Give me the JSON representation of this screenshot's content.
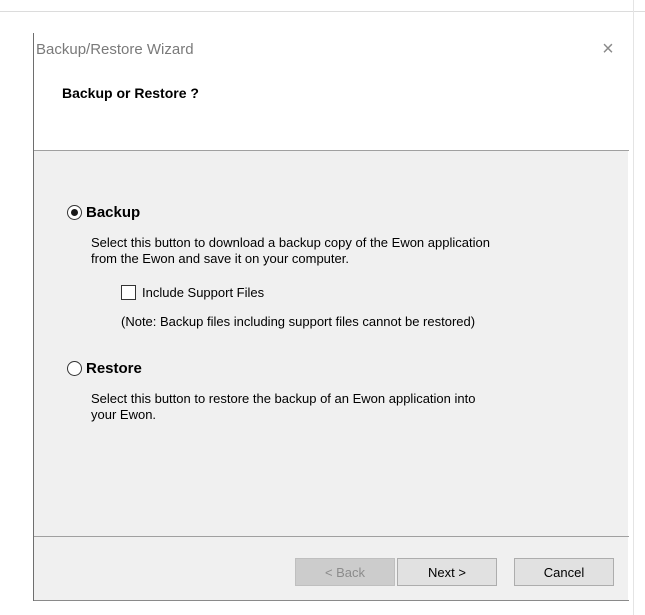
{
  "window": {
    "title": "Backup/Restore Wizard",
    "close_glyph": "×",
    "close_icon": "close-icon"
  },
  "header": {
    "title": "Backup or Restore ?"
  },
  "options": {
    "backup": {
      "label": "Backup",
      "selected": true,
      "description_line1": "Select this button to download a backup copy of the Ewon application",
      "description_line2": "from the Ewon and save it on your computer."
    },
    "include_support": {
      "label": "Include Support Files",
      "checked": false
    },
    "note": "(Note: Backup files including support files cannot be restored)",
    "restore": {
      "label": "Restore",
      "selected": false,
      "description_line1": "Select this button to restore the backup of an Ewon application into",
      "description_line2": "your Ewon."
    }
  },
  "buttons": {
    "back": "< Back",
    "next": "Next >",
    "cancel": "Cancel"
  },
  "colors": {
    "dialog_background": "#f0f0f0",
    "header_background": "#ffffff",
    "disabled_text": "#8c8c8c"
  }
}
